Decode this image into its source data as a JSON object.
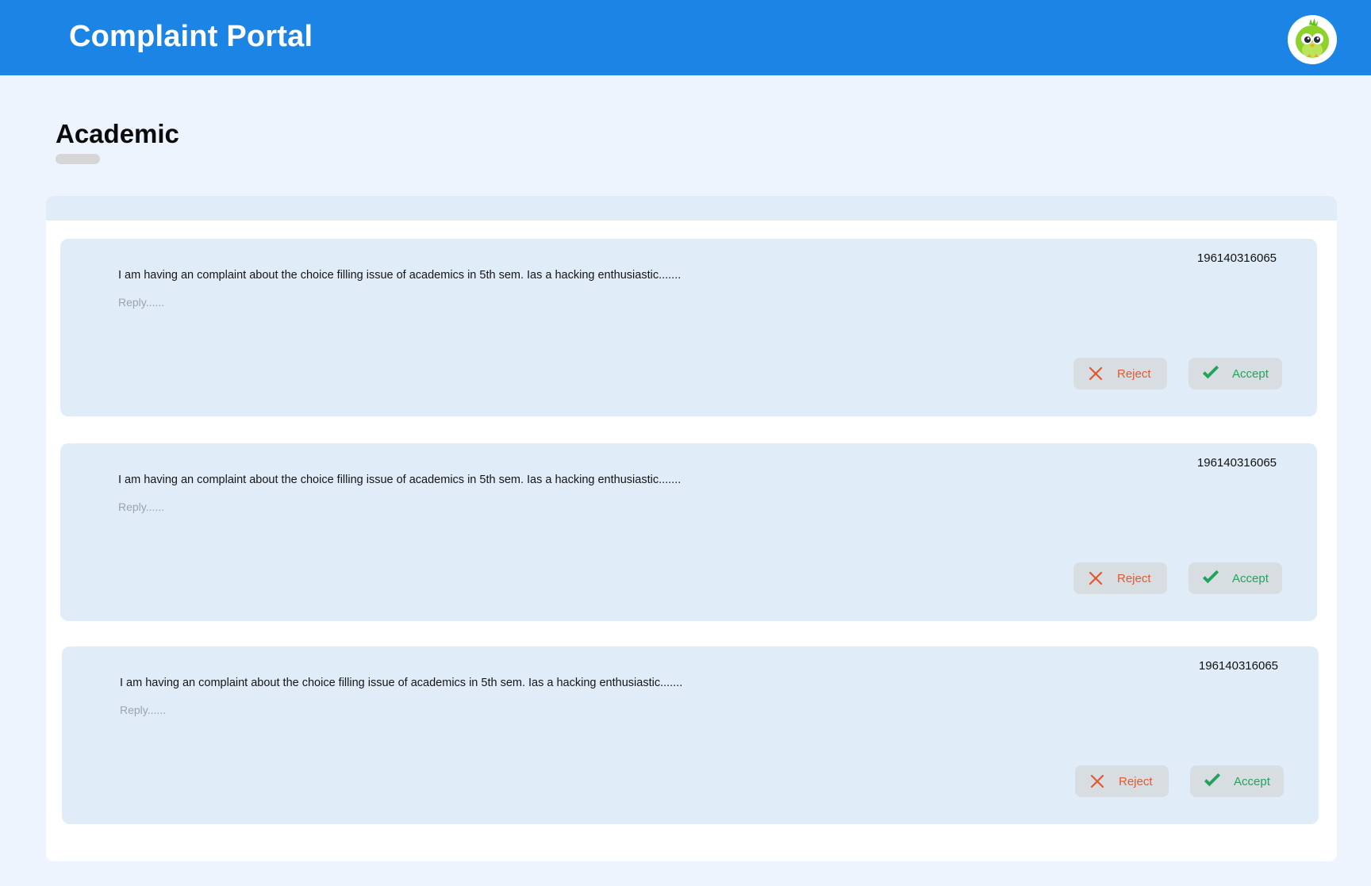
{
  "header": {
    "title": "Complaint Portal",
    "avatar_icon": "bird-mascot-avatar-icon",
    "color": "#1b84e5"
  },
  "page": {
    "title": "Academic"
  },
  "complaints": [
    {
      "id": "196140316065",
      "message": "I am having an complaint about the choice filling issue of academics in 5th sem. Ias a hacking enthusiastic.......",
      "reply_placeholder": "Reply......",
      "reject_label": "Reject",
      "accept_label": "Accept"
    },
    {
      "id": "196140316065",
      "message": "I am having an complaint about the choice filling issue of academics in 5th sem. Ias a hacking enthusiastic.......",
      "reply_placeholder": "Reply......",
      "reject_label": "Reject",
      "accept_label": "Accept"
    },
    {
      "id": "196140316065",
      "message": "I am having an complaint about the choice filling issue of academics in 5th sem. Ias a hacking enthusiastic.......",
      "reply_placeholder": "Reply......",
      "reject_label": "Reject",
      "accept_label": "Accept"
    }
  ],
  "colors": {
    "reject": "#e3582b",
    "accept": "#22a35b",
    "card_bg": "#e0ecf8",
    "page_bg": "#eef4fe"
  }
}
